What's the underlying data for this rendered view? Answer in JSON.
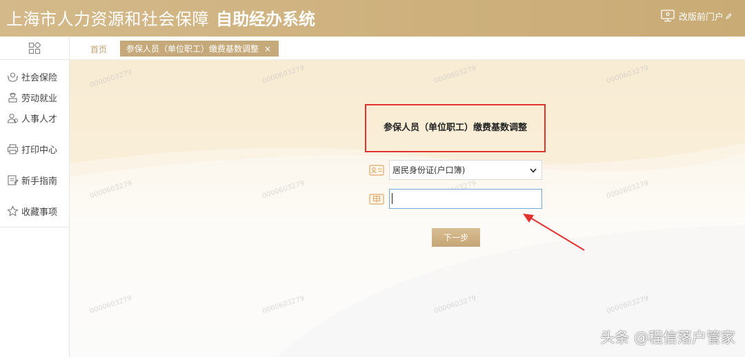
{
  "header": {
    "title_main": "上海市人力资源和社会保障",
    "title_sub": "自助经办系统",
    "portal_link_label": "改版前门户"
  },
  "sidebar": {
    "items": [
      {
        "label": "社会保险",
        "icon": "social-insurance-icon"
      },
      {
        "label": "劳动就业",
        "icon": "employment-icon"
      },
      {
        "label": "人事人才",
        "icon": "talent-icon"
      },
      {
        "label": "打印中心",
        "icon": "printer-icon"
      },
      {
        "label": "新手指南",
        "icon": "guide-icon"
      },
      {
        "label": "收藏事项",
        "icon": "star-icon"
      }
    ]
  },
  "tabs": {
    "home_label": "首页",
    "active_label": "参保人员（单位职工）缴费基数调整",
    "close_glyph": "×"
  },
  "form": {
    "title": "参保人员（单位职工）缴费基数调整",
    "id_type_selected": "居民身份证(户口簿)",
    "id_number_value": "",
    "next_button_label": "下一步"
  },
  "watermark_text": "0000603279",
  "credit_text": "头条 @程信落户管家",
  "colors": {
    "header_gold": "#cdb07c",
    "tab_active": "#c6a97b",
    "highlight_red": "#e0322f",
    "input_focus": "#74a7d9"
  }
}
